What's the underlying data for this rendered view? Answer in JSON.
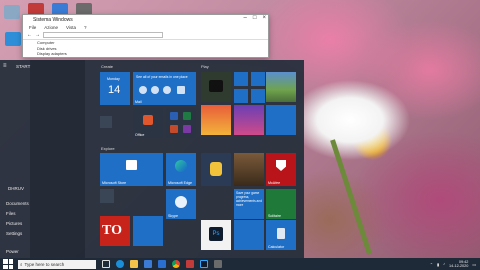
{
  "explorer": {
    "title": "Sistema Windows",
    "menu": [
      "File",
      "Azione",
      "Vista",
      "?"
    ],
    "rows": [
      "Computer",
      "Disk drives",
      "Display adapters"
    ]
  },
  "start": {
    "label": "START",
    "user": "DHRUV",
    "links": [
      "Documents",
      "Files",
      "Pictures",
      "Settings",
      "Power"
    ]
  },
  "groups": {
    "create": "Create",
    "play": "Play",
    "explore": "Explore"
  },
  "tiles": {
    "calendar_day": "Monday",
    "calendar_date": "14",
    "mail_text": "See all of your emails in one place",
    "mail_label": "Mail",
    "office": "Office",
    "store": "Microsoft Store",
    "edge": "Microsoft Edge",
    "skype": "Skype",
    "ad_text": "Save your game progress, achievements and more",
    "ad_label": "Solitaire",
    "calculator": "Calculator",
    "mcafee": "McAfee",
    "photoshop": "Ps"
  },
  "taskbar": {
    "search_placeholder": "Type here to search",
    "time": "09:42",
    "date": "14-12-2020"
  },
  "colors": {
    "tile_blue": "#1f6fc6",
    "taskbar": "#1e2a38",
    "start_bg": "#232d3a"
  }
}
